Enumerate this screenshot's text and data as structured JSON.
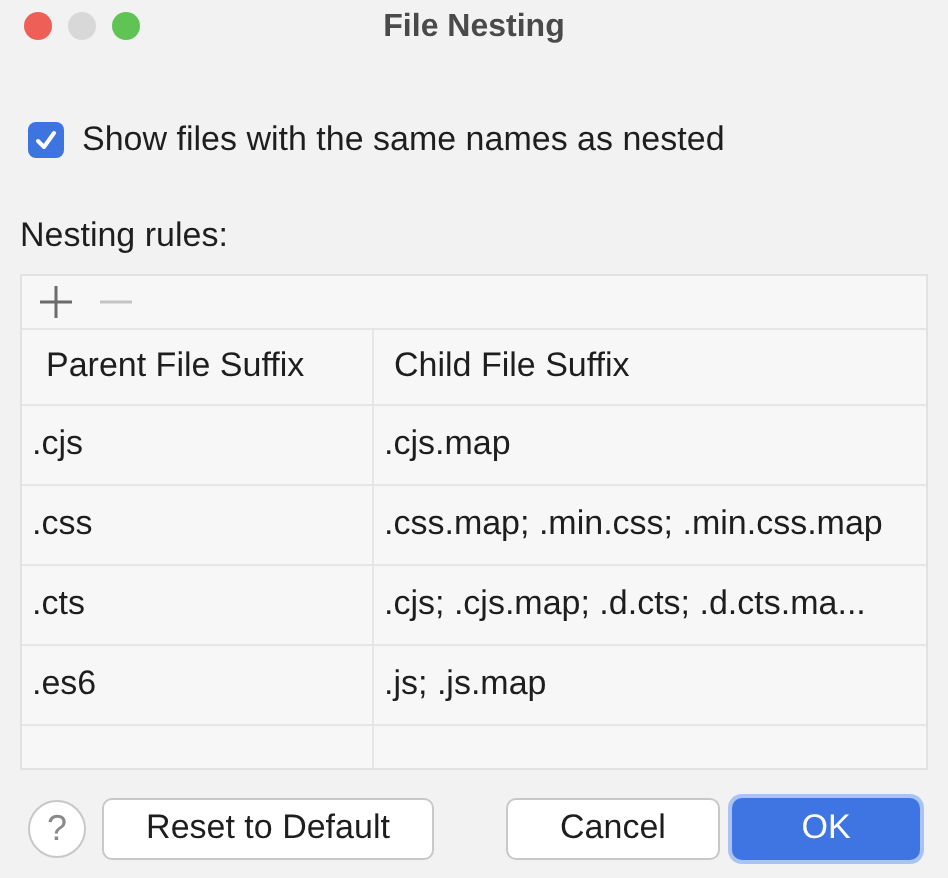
{
  "window": {
    "title": "File Nesting"
  },
  "option": {
    "label": "Show files with the same names as nested",
    "checked": true
  },
  "rules_label": "Nesting rules:",
  "table": {
    "columns": [
      "Parent File Suffix",
      "Child File Suffix"
    ],
    "rows": [
      {
        "parent": ".cjs",
        "child": ".cjs.map"
      },
      {
        "parent": ".css",
        "child": ".css.map; .min.css; .min.css.map"
      },
      {
        "parent": ".cts",
        "child": ".cjs; .cjs.map; .d.cts; .d.cts.ma..."
      },
      {
        "parent": ".es6",
        "child": ".js; .js.map"
      }
    ]
  },
  "buttons": {
    "help": "?",
    "reset": "Reset to Default",
    "cancel": "Cancel",
    "ok": "OK"
  }
}
